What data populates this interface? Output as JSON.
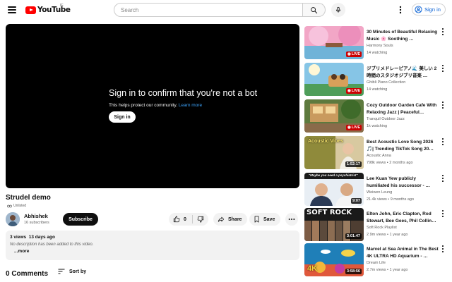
{
  "header": {
    "logo_text": "YouTube",
    "country_code": "IE",
    "search_placeholder": "Search",
    "signin_label": "Sign in"
  },
  "player": {
    "title": "Sign in to confirm that you're not a bot",
    "subtitle": "This helps protect our community.",
    "learn_more": "Learn more",
    "signin_button": "Sign in"
  },
  "video": {
    "title": "Strudel demo",
    "visibility": "Unlisted",
    "channel": "Abhishek",
    "subscribers": "16 subscribers",
    "subscribe_label": "Subscribe",
    "likes": "0",
    "share_label": "Share",
    "save_label": "Save",
    "views": "3 views",
    "date": "13 days ago",
    "description": "No description has been added to this video.",
    "more_label": "...more"
  },
  "comments": {
    "count_label": "0 Comments",
    "sort_label": "Sort by"
  },
  "sidebar": {
    "items": [
      {
        "title": "30 Minutes of Beautiful Relaxing Music 🌸 Soothing …",
        "channel": "Harmony Souls",
        "meta": "14 watching",
        "badge": "LIVE",
        "is_live": true
      },
      {
        "title": "ジブリメドレーピアノ🌊 美しい 2時間のスタジオジブリ音楽 …",
        "channel": "Ghibli Piano Collection",
        "meta": "14 watching",
        "badge": "LIVE",
        "is_live": true
      },
      {
        "title": "Cozy Outdoor Garden Cafe With Relaxing Jazz | Peaceful…",
        "channel": "Tranquil Outdoor Jazz",
        "meta": "1k watching",
        "badge": "LIVE",
        "is_live": true
      },
      {
        "title": "Best Acoustic Love Song 2026 🎵| Trending TikTok Song 20…",
        "channel": "Acoustic Anna",
        "meta": "798k views • 2 months ago",
        "badge": "1:52:17",
        "is_live": false,
        "thumb_text": "Acoustic Vibes"
      },
      {
        "title": "Lee Kuan Yew publicly humiliated his successor - …",
        "channel": "Weiwen Leung",
        "meta": "21.4k views • 9 months ago",
        "badge": "9:07",
        "is_live": false,
        "thumb_text": "\"Maybe you need a psychiatrist\""
      },
      {
        "title": "Elton John, Eric Clapton, Rod Stewart, Bee Gees, Phil Collin…",
        "channel": "Soft Rock Playlist",
        "meta": "2.9m views • 1 year ago",
        "badge": "3:01:47",
        "is_live": false,
        "thumb_text": "SOFT ROCK"
      },
      {
        "title": "Marvel at Sea Animal in The Best 4K ULTRA HD Aquarium - …",
        "channel": "Dream Life",
        "meta": "2.7m views • 1 year ago",
        "badge": "3:58:56",
        "is_live": false,
        "thumb_text": "4K"
      }
    ]
  }
}
